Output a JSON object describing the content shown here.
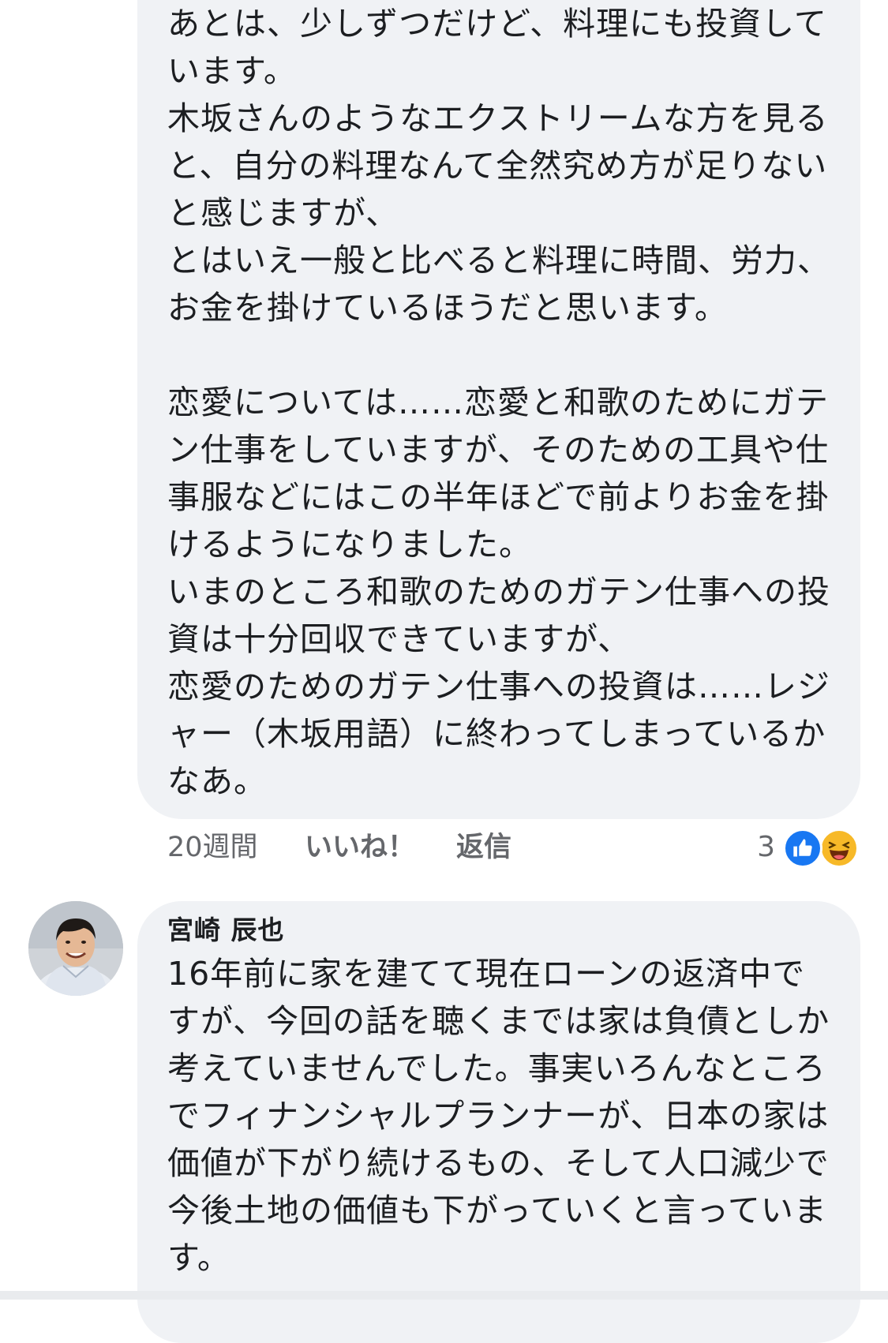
{
  "comments": [
    {
      "text": "あとは、少しずつだけど、料理にも投資して\nいます。\n木坂さんのようなエクストリームな方を見る\nと、自分の料理なんて全然究め方が足りない\nと感じますが、\nとはいえ一般と比べると料理に時間、労力、\nお金を掛けているほうだと思います。\n\n恋愛については……恋愛と和歌のためにガテ\nン仕事をしていますが、そのための工具や仕\n事服などにはこの半年ほどで前よりお金を掛\nけるようになりました。\nいまのところ和歌のためのガテン仕事への投\n資は十分回収できていますが、\n恋愛のためのガテン仕事への投資は……レジ\nャー（木坂用語）に終わってしまっているか\nなあ。",
      "time": "20週間",
      "like_label": "いいね！",
      "reply_label": "返信",
      "reaction_count": "3",
      "reactions": [
        "like-icon",
        "haha-icon"
      ]
    },
    {
      "author": "宮崎 辰也",
      "text": "16年前に家を建てて現在ローンの返済中で\nすが、今回の話を聴くまでは家は負債としか\n考えていませんでした。事実いろんなところ\nでフィナンシャルプランナーが、日本の家は\n価値が下がり続けるもの、そして人口減少で\n今後土地の価値も下がっていくと言っていま\nす。"
    }
  ],
  "colors": {
    "bubble_bg": "#f0f2f5",
    "meta_text": "#65676b",
    "like_blue": "#1877f2",
    "haha_yellow": "#f7b928"
  }
}
